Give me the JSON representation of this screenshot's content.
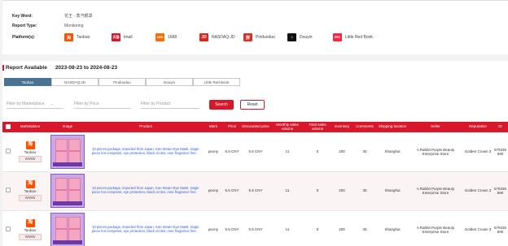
{
  "info": {
    "keyword_label": "Key Word:",
    "keyword_value": "花王 · 蒸汽眼罩",
    "report_type_label": "Report Type:",
    "report_type_value": "Monitoring",
    "platforms_label": "Platform(s):",
    "platforms": [
      {
        "name": "Taobao",
        "logo_text": "淘",
        "color": "#ff5000"
      },
      {
        "name": "tmall",
        "logo_text": "天猫",
        "color": "#d9172a"
      },
      {
        "name": "1688",
        "logo_text": "1688",
        "color": "#ff6a00"
      },
      {
        "name": "NASDAQ:JD",
        "logo_text": "JD",
        "color": "#e1251b"
      },
      {
        "name": "Pinduoduo",
        "logo_text": "拼",
        "color": "#e02e24"
      },
      {
        "name": "Douyin",
        "logo_text": "♪",
        "color": "#111111"
      },
      {
        "name": "Little Red Book",
        "logo_text": "RED",
        "color": "#ff2442"
      }
    ]
  },
  "report": {
    "title": "Report Available",
    "range": "2023-08-23 to 2024-08-23",
    "tabs": [
      "Taobao",
      "NASDAQ:JD",
      "Pinduoduo",
      "Douyin",
      "Little Red Book"
    ],
    "active_tab": 0
  },
  "filters": {
    "marketplace_placeholder": "Filter by Marketplace",
    "price_placeholder": "Filter by Price",
    "product_placeholder": "Filter by Product",
    "search_label": "Search",
    "reset_label": "Reset"
  },
  "table": {
    "headers": [
      "",
      "Marketplace",
      "Image",
      "Product",
      "Mark",
      "Price",
      "Discounted price",
      "Monthly sales volume",
      "Total sales volume",
      "Inventory",
      "Comments",
      "Shipping location",
      "Seller",
      "Reputation",
      "ID"
    ],
    "rows": [
      {
        "marketplace": "Taobao",
        "logo_text": "淘",
        "link": "WWW",
        "product": "10 pieces package, imported from Japan, Kao Steam Eye Mask, single piece hot compress, eye protection, black circles, rose fragrance free",
        "mark": "peony",
        "price": "5.5 CNY",
        "discounted": "5.5 CNY",
        "monthly": "11",
        "total": "0",
        "inventory": "200",
        "comments": "30",
        "shipping": "Shanghai",
        "seller": "A Rabbit Purple Beauty Enterprise Store",
        "reputation": "Golden Crown 3",
        "id": "679335 690"
      },
      {
        "marketplace": "Taobao",
        "logo_text": "淘",
        "link": "WWW",
        "product": "10 pieces package, imported from Japan, Kao Steam Eye Mask, single piece hot compress, eye protection, black circles, rose fragrance free",
        "mark": "peony",
        "price": "5.5 CNY",
        "discounted": "5.5 CNY",
        "monthly": "11",
        "total": "0",
        "inventory": "200",
        "comments": "30",
        "shipping": "Shanghai",
        "seller": "A Rabbit Purple Beauty Enterprise Store",
        "reputation": "Golden Crown 3",
        "id": "679335 690"
      },
      {
        "marketplace": "Taobao",
        "logo_text": "淘",
        "link": "WWW",
        "product": "10 pieces package, imported from Japan, Kao Steam Eye Mask, single piece hot compress, eye protection, black circles, rose fragrance free",
        "mark": "peony",
        "price": "5.5 CNY",
        "discounted": "5.5 CNY",
        "monthly": "11",
        "total": "0",
        "inventory": "200",
        "comments": "30",
        "shipping": "Shanghai",
        "seller": "A Rabbit Purple Beauty Enterprise Store",
        "reputation": "Golden Crown 3",
        "id": "679335 690"
      }
    ]
  },
  "colors": {
    "accent": "#d9172a",
    "active_tab": "#4a7393",
    "product_link": "#2b5fd6"
  }
}
